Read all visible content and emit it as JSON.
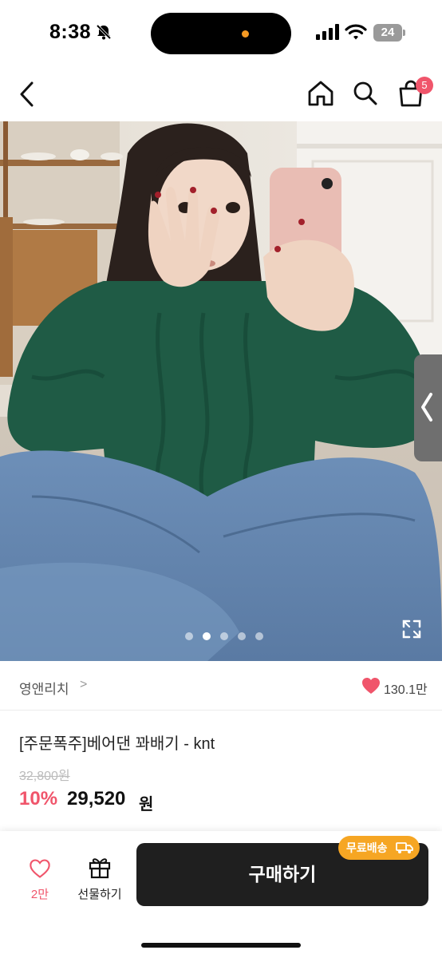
{
  "status_bar": {
    "time": "8:38",
    "battery": "24"
  },
  "nav": {
    "cart_badge": "5"
  },
  "carousel": {
    "total_images": 5,
    "active_index": 1
  },
  "seller": {
    "name": "영앤리치",
    "chevron": ">",
    "like_count": "130.1만"
  },
  "product": {
    "title": "[주문폭주]베어댄 꽈배기 - knt",
    "original_price": "32,800원",
    "discount": "10%",
    "sale_price": "29,520",
    "sale_unit": "원"
  },
  "bottom_bar": {
    "wish_count": "2만",
    "gift_label": "선물하기",
    "buy_label": "구매하기",
    "free_shipping_label": "무료배송"
  },
  "colors": {
    "accent_pink": "#f0556b",
    "free_ship_orange": "#f6a623",
    "buy_button": "#1f1f1f"
  }
}
